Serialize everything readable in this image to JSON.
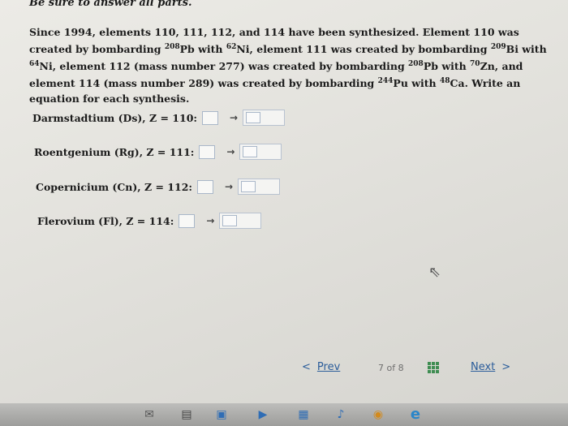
{
  "header": {
    "text": "Be sure to answer all parts."
  },
  "question": {
    "p1": "Since 1994, elements 110, 111, 112, and 114 have been synthesized. Element 110 was created by bombarding ",
    "sup1": "208",
    "p2": "Pb with ",
    "sup2": "62",
    "p3": "Ni, element 111 was created by bombarding ",
    "sup3": "209",
    "p4": "Bi with ",
    "sup4": "64",
    "p5": "Ni, element 112 (mass number 277) was created by bombarding ",
    "sup5": "208",
    "p6": "Pb with ",
    "sup6": "70",
    "p7": "Zn, and element 114 (mass number 289) was created by bombarding ",
    "sup7": "244",
    "p8": "Pu with ",
    "sup8": "48",
    "p9": "Ca. Write an equation for each synthesis."
  },
  "rows": [
    {
      "label": "Darmstadtium (Ds), Z = 110:"
    },
    {
      "label": "Roentgenium (Rg), Z = 111:"
    },
    {
      "label": "Copernicium (Cn), Z = 112:"
    },
    {
      "label": "Flerovium (Fl), Z = 114:"
    }
  ],
  "arrow": "→",
  "nav": {
    "prev_label": "Prev",
    "prev_chevron": "<",
    "page_indicator": "7 of 8",
    "next_label": "Next",
    "next_chevron": ">"
  },
  "taskbar_icons": [
    "mail-icon",
    "task-view-icon",
    "store-icon",
    "video-icon",
    "photos-icon",
    "music-icon",
    "chrome-icon",
    "edge-icon"
  ],
  "colors": {
    "link": "#2b5d9a",
    "grid_icon": "#3f8d52"
  }
}
